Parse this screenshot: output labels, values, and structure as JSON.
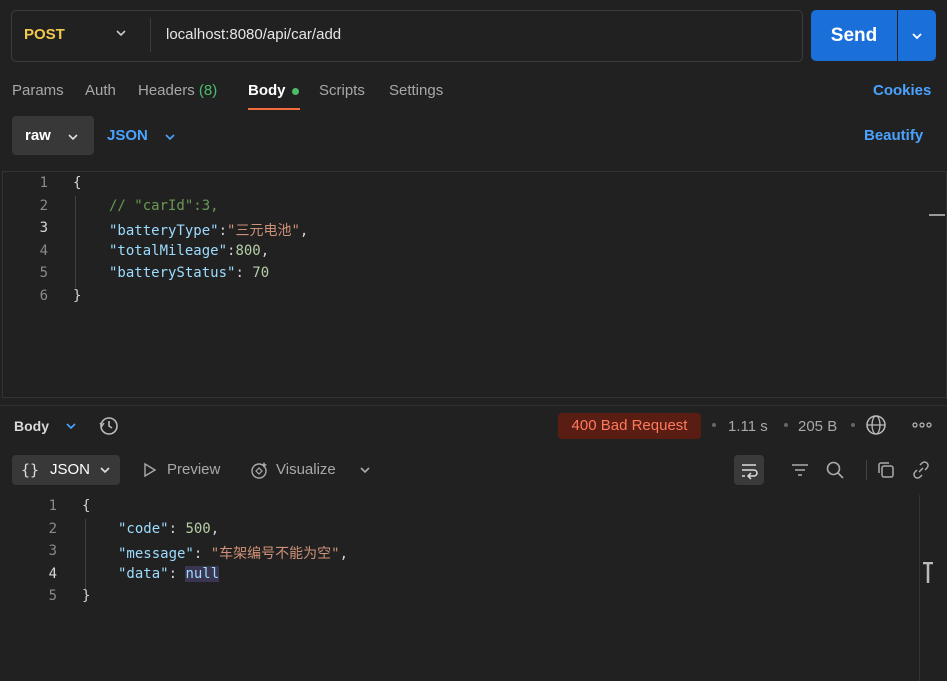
{
  "request": {
    "method": "POST",
    "url": "localhost:8080/api/car/add",
    "send_label": "Send"
  },
  "tabs": {
    "params": "Params",
    "auth": "Auth",
    "headers": "Headers",
    "headers_count": "(8)",
    "body": "Body",
    "scripts": "Scripts",
    "settings": "Settings",
    "cookies": "Cookies"
  },
  "body_options": {
    "mode": "raw",
    "language": "JSON",
    "beautify": "Beautify"
  },
  "editor": {
    "line_numbers": [
      "1",
      "2",
      "3",
      "4",
      "5",
      "6"
    ],
    "comment": "// \"carId\":3,",
    "battery_type_key": "\"batteryType\"",
    "battery_type_value": "\"三元电池\"",
    "total_mileage_key": "\"totalMileage\"",
    "total_mileage_value": "800",
    "battery_status_key": "\"batteryStatus\"",
    "battery_status_value": "70"
  },
  "response": {
    "section_label": "Body",
    "status": "400 Bad Request",
    "time": "1.11 s",
    "size": "205 B",
    "format": "JSON",
    "preview": "Preview",
    "visualize": "Visualize",
    "line_numbers": [
      "1",
      "2",
      "3",
      "4",
      "5"
    ],
    "code_key": "\"code\"",
    "code_value": "500",
    "message_key": "\"message\"",
    "message_value": "\"车架编号不能为空\"",
    "data_key": "\"data\"",
    "data_value": "null"
  },
  "colors": {
    "send": "#1a6fd9",
    "method": "#f3c94d",
    "link": "#4aa3ff",
    "status_bg": "#5a1d14",
    "status_text": "#ff7a5c"
  }
}
